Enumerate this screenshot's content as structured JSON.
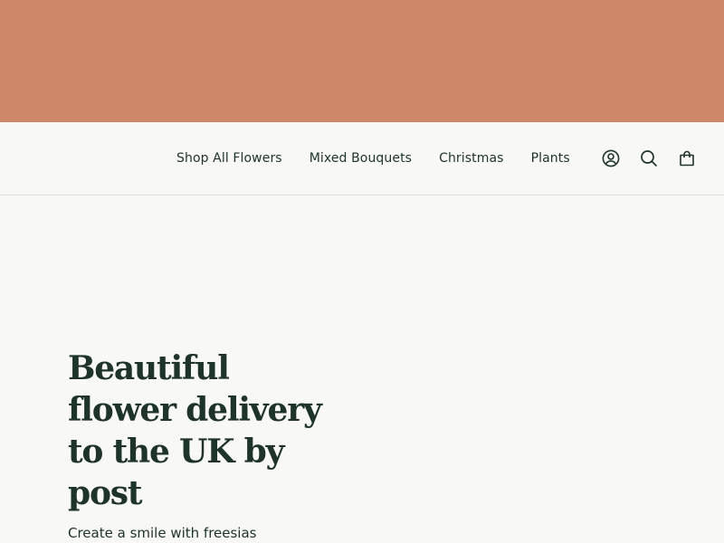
{
  "header": {
    "nav": [
      {
        "label": "Shop All Flowers"
      },
      {
        "label": "Mixed Bouquets"
      },
      {
        "label": "Christmas"
      },
      {
        "label": "Plants"
      }
    ],
    "icons": [
      "account-icon",
      "search-icon",
      "cart-icon"
    ]
  },
  "hero": {
    "title": "Beautiful flower delivery to the UK by post",
    "subtitle": "Create a smile with freesias"
  },
  "colors": {
    "banner": "#cc8868",
    "background": "#f8f8f5",
    "text": "#1e3329"
  }
}
